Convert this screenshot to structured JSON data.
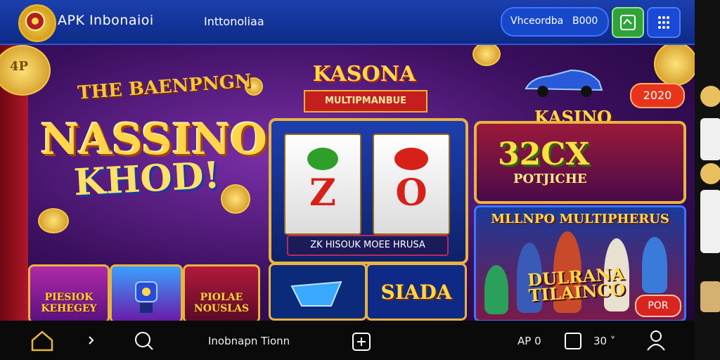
{
  "header": {
    "brand": "APK Inbonaioi",
    "region": "Inttonoliaa",
    "language_pill": {
      "label": "Vhceordba",
      "value": "B000"
    }
  },
  "hero": {
    "title_top": "THE BAENPNGN",
    "title_main": "NASSINO",
    "title_sub": "KHOD!",
    "coin_label": "4P",
    "thumbnails": [
      {
        "label": "PIESIOK KEHEGEY"
      },
      {
        "label": ""
      },
      {
        "label": "PIOLAE NOUSLAS"
      }
    ]
  },
  "kasona": {
    "title": "KASONA",
    "ribbon": "MULTIPMANBUE"
  },
  "slot": {
    "symbols": [
      "Z",
      "O"
    ],
    "bar_text": "ZK HISOUK MOEE HRUSA"
  },
  "bottom_tiles": {
    "right_label": "SIADA"
  },
  "promo": {
    "badge": "2020",
    "kasino_label": "KASINO",
    "big": "32CX",
    "sub": "POTJICHE"
  },
  "multipliers": {
    "title": "MLLNPO MULTIPHERUS",
    "logo_line1": "DULRANA",
    "logo_line2": "TILAINCO",
    "cta": "POR"
  },
  "bottom_nav": {
    "search_label": "Inobnapn Tionn",
    "ap_label": "AP 0",
    "count_label": "30 ˅"
  },
  "colors": {
    "header_blue": "#0d2a86",
    "accent_gold": "#e8b440",
    "cta_red": "#d8251f",
    "gift_green": "#2fa33a"
  }
}
